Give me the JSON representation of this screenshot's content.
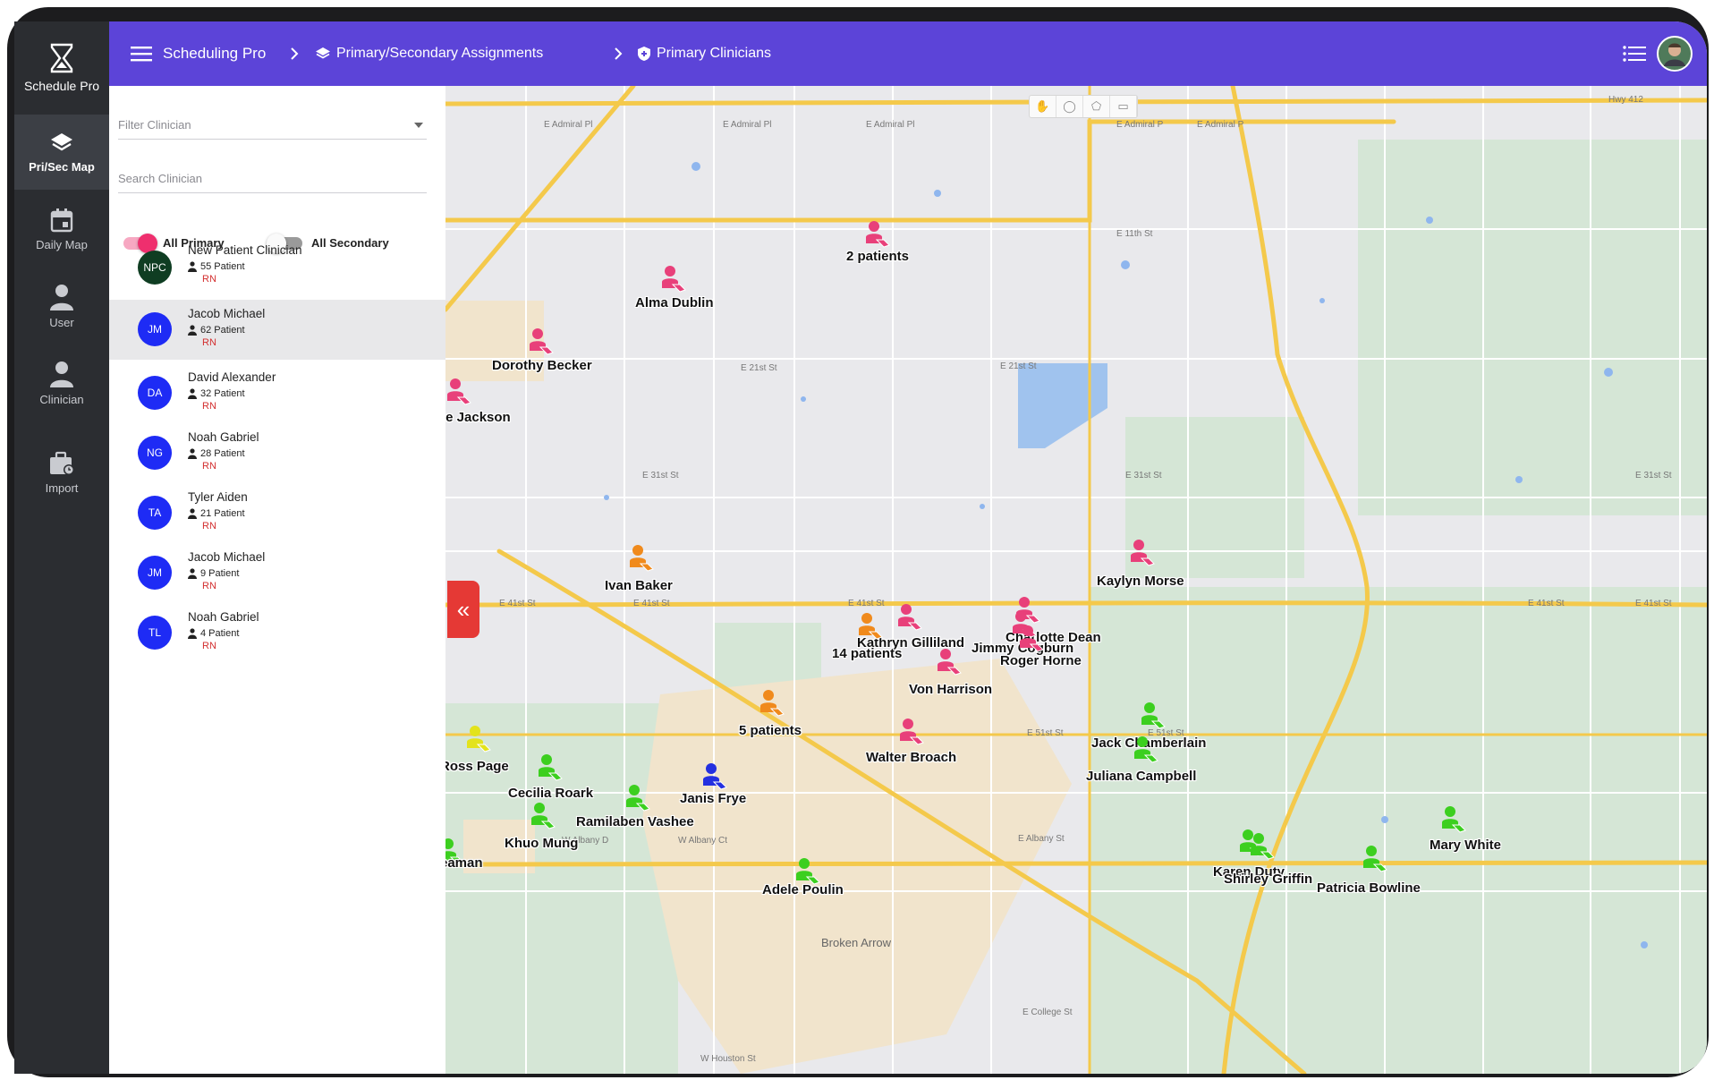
{
  "app": {
    "brand": "Schedule Pro",
    "title": "Scheduling Pro"
  },
  "rail": [
    {
      "label": "Pri/Sec Map",
      "icon": "layers-icon",
      "active": true
    },
    {
      "label": "Daily Map",
      "icon": "calendar-icon",
      "active": false
    },
    {
      "label": "User",
      "icon": "user-icon",
      "active": false
    },
    {
      "label": "Clinician",
      "icon": "clinician-icon",
      "active": false
    },
    {
      "label": "Import",
      "icon": "briefcase-clock-icon",
      "active": false
    }
  ],
  "breadcrumb": [
    {
      "label": "Primary/Secondary Assignments",
      "icon": "layers-icon"
    },
    {
      "label": "Primary Clinicians",
      "icon": "shield-plus-icon"
    }
  ],
  "sidebar": {
    "filter_placeholder": "Filter Clinician",
    "search_placeholder": "Search Clinician",
    "toggle_primary": "All Primary",
    "toggle_secondary": "All Secondary",
    "clinicians": [
      {
        "initials": "NPC",
        "name": "New Patient Clinician",
        "count": "55 Patient",
        "role": "RN",
        "color": "#0f3d22"
      },
      {
        "initials": "JM",
        "name": "Jacob Michael",
        "count": "62 Patient",
        "role": "RN",
        "color": "#1e2bf5",
        "selected": true
      },
      {
        "initials": "DA",
        "name": "David Alexander",
        "count": "32 Patient",
        "role": "RN",
        "color": "#1e2bf5"
      },
      {
        "initials": "NG",
        "name": "Noah Gabriel",
        "count": "28 Patient",
        "role": "RN",
        "color": "#1e2bf5"
      },
      {
        "initials": "TA",
        "name": "Tyler Aiden",
        "count": "21 Patient",
        "role": "RN",
        "color": "#1e2bf5"
      },
      {
        "initials": "JM",
        "name": "Jacob Michael",
        "count": "9 Patient",
        "role": "RN",
        "color": "#1e2bf5"
      },
      {
        "initials": "TL",
        "name": "Noah Gabriel",
        "count": "4 Patient",
        "role": "RN",
        "color": "#1e2bf5"
      }
    ]
  },
  "map": {
    "streets": [
      "E Admiral Pl",
      "E Admiral Pl",
      "E Admiral Pl",
      "E Admiral P",
      "E Admiral P",
      "E 11th St",
      "E 21st St",
      "E 21st St",
      "E 31st St",
      "E 31st St",
      "E 31st St",
      "E 41st St",
      "E 41st St",
      "E 41st St",
      "E 41st St",
      "E 41st St",
      "E 51st St",
      "E 51st St",
      "W Albany D",
      "W Albany Ct",
      "E Albany St",
      "E College St",
      "W Houston St",
      "Hwy 412",
      "Broken Arrow"
    ],
    "markers": [
      {
        "label": "2 patients",
        "color": "#e8407a"
      },
      {
        "label": "Alma Dublin",
        "color": "#e8407a"
      },
      {
        "label": "Dorothy Becker",
        "color": "#e8407a"
      },
      {
        "label": "ie Jackson",
        "color": "#e8407a"
      },
      {
        "label": "Ivan Baker",
        "color": "#f08a1c"
      },
      {
        "label": "Kaylyn Morse",
        "color": "#e8407a"
      },
      {
        "label": "Kathryn Gilliland",
        "color": "#e8407a"
      },
      {
        "label": "14 patients",
        "color": "#f08a1c"
      },
      {
        "label": "Charlotte Dean",
        "color": "#e8407a"
      },
      {
        "label": "Jimmy Cogburn",
        "color": "#e8407a"
      },
      {
        "label": "Roger Horne",
        "color": "#e8407a"
      },
      {
        "label": "Von Harrison",
        "color": "#e8407a"
      },
      {
        "label": "5 patients",
        "color": "#f08a1c"
      },
      {
        "label": "Walter Broach",
        "color": "#e8407a"
      },
      {
        "label": "Jack Chamberlain",
        "color": "#3ccf1f"
      },
      {
        "label": "Juliana Campbell",
        "color": "#3ccf1f"
      },
      {
        "label": "Ross Page",
        "color": "#e3e31b"
      },
      {
        "label": "Cecilia Roark",
        "color": "#3ccf1f"
      },
      {
        "label": "Janis Frye",
        "color": "#2430e0"
      },
      {
        "label": "Ramilaben Vashee",
        "color": "#3ccf1f"
      },
      {
        "label": "Khuo Mung",
        "color": "#3ccf1f"
      },
      {
        "label": "Karen Duty",
        "color": "#3ccf1f"
      },
      {
        "label": "Shirley Griffin",
        "color": "#3ccf1f"
      },
      {
        "label": "Mary White",
        "color": "#3ccf1f"
      },
      {
        "label": "Patricia Bowline",
        "color": "#3ccf1f"
      },
      {
        "label": "Adele Poulin",
        "color": "#3ccf1f"
      },
      {
        "label": "eaman",
        "color": "#3ccf1f"
      }
    ]
  },
  "colors": {
    "topbar": "#5c44d8",
    "rail": "#2b2d31",
    "accent": "#ef2f6e",
    "collapse": "#e53935"
  }
}
